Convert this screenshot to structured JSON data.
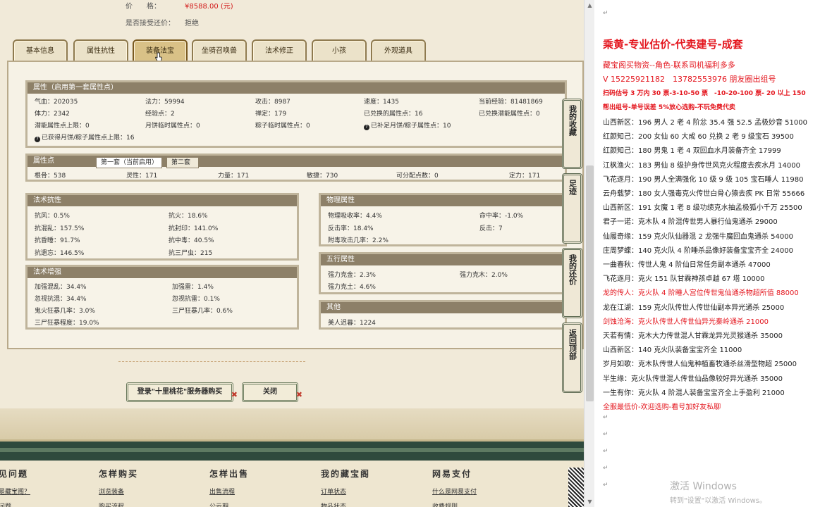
{
  "listing": {
    "price_label": "价　　格：",
    "price_value": "¥8588.00 (元)",
    "bargain_label": "是否接受还价：",
    "bargain_value": "拒绝"
  },
  "tabs": [
    "基本信息",
    "属性抗性",
    "装备法宝",
    "坐骑召唤兽",
    "法术修正",
    "小孩",
    "外观道具"
  ],
  "attr": {
    "title": "属性（启用第一套属性点）",
    "rows": [
      [
        "气血：202035",
        "法力：59994",
        "攻击：8987",
        "速度：1435",
        "当前经验：81481869"
      ],
      [
        "体力：2342",
        "经验点：2",
        "禅定：179",
        "已兑换的属性点：16",
        "已兑换潜能属性点：0"
      ],
      [
        "潜能属性点上限：0",
        "月饼临时属性点：0",
        "粽子临时属性点：0",
        "已补足月饼/粽子属性点：10",
        ""
      ]
    ],
    "note": "已获得月饼/粽子属性点上限：16"
  },
  "points": {
    "title": "属性点",
    "subtabs": [
      "第一套（当前启用）",
      "第二套"
    ],
    "row": [
      "根骨：538",
      "灵性：171",
      "力量：171",
      "敏捷：730",
      "可分配点数：0",
      "定力：171"
    ]
  },
  "resist": {
    "title": "法术抗性",
    "rows": [
      [
        "抗风：0.5%",
        "抗火：18.6%"
      ],
      [
        "抗混乱：157.5%",
        "抗封印：141.0%"
      ],
      [
        "抗昏睡：91.7%",
        "抗中毒：40.5%"
      ],
      [
        "抗遗忘：146.5%",
        "抗三尸虫：215"
      ]
    ]
  },
  "physical": {
    "title": "物理属性",
    "rows": [
      [
        "物理吸收率：4.4%",
        "命中率：-1.0%"
      ],
      [
        "反击率：18.4%",
        "反击：7"
      ],
      [
        "附毒攻击几率：2.2%",
        ""
      ]
    ]
  },
  "enhance": {
    "title": "法术增强",
    "rows": [
      [
        "加强混乱：34.4%",
        "加强雷：1.4%"
      ],
      [
        "忽视抗混：34.4%",
        "忽视抗雷：0.1%"
      ],
      [
        "鬼火狂暴几率：3.0%",
        "三尸狂暴几率：0.6%"
      ],
      [
        "三尸狂暴程度：19.0%",
        ""
      ]
    ]
  },
  "five": {
    "title": "五行属性",
    "rows": [
      [
        "强力克金：2.3%",
        "强力克木：2.0%"
      ],
      [
        "强力克土：4.6%",
        ""
      ]
    ]
  },
  "other": {
    "title": "其他",
    "rows": [
      "美人迟暮：1224"
    ]
  },
  "buttons": {
    "login": "登录\"十里桃花\"服务器购买",
    "close": "关闭"
  },
  "side_tabs": [
    "我的收藏",
    "足迹",
    "我的还价",
    "返回顶部"
  ],
  "footer": [
    {
      "h": "见问题",
      "l1": "是藏宝阁？",
      "l2": "问题"
    },
    {
      "h": "怎样购买",
      "l1": "浏览装备",
      "l2": "购买流程"
    },
    {
      "h": "怎样出售",
      "l1": "出售流程",
      "l2": "公示期"
    },
    {
      "h": "我的藏宝阁",
      "l1": "订单状态",
      "l2": "物品状态"
    },
    {
      "h": "网易支付",
      "l1": "什么是网易支付",
      "l2": "收费规则"
    }
  ],
  "right": {
    "title": "乘黄-专业估价-代卖建号-成套",
    "line2": "藏宝阁买物资--角色-联系司机福利多多",
    "line3": "V 15225921182　13782553976 朋友圈出组号",
    "line4": "扫码估号 3 万内 30 票-3-10-50 票　-10-20-100 票- 20 以上 150",
    "line5": "帮出组号-单号误差 5%放心选购-不玩免费代卖",
    "items": [
      {
        "t": "山西新区：196 男人 2 老 4 阶忿 35.4 强 52.5 孟极妙音 51000",
        "red": false
      },
      {
        "t": "红颜知己：200 女仙 60 大成 60 兑换 2 老 9 级宝石 39500",
        "red": false
      },
      {
        "t": "红颜知己：180 男鬼 1 老 4 双回血水月装备齐全 17999",
        "red": false
      },
      {
        "t": "江枫渔火：183 男仙 8 级护身传世风克火程度去疾水月 14000",
        "red": false
      },
      {
        "t": "飞花逐月：190 男人全满强化 10 级 9 级 105 宝石睡人 11980",
        "red": false
      },
      {
        "t": "云舟载梦：180 女人强毒克火传世白骨心猿去疾 PK 日常 55666",
        "red": false
      },
      {
        "t": "山西新区：191 女魔 1 老 8 级功绩克水抽孟极狐小千万 25500",
        "red": false
      },
      {
        "t": "君子一诺：克木队 4 阶混传世男人暴行仙鬼通杀 29000",
        "red": false
      },
      {
        "t": "仙履奇缘：159 克火队仙器混 2 龙强牛魔回血鬼通杀 54000",
        "red": false
      },
      {
        "t": "庄周梦蝶：140 克火队 4 阶睡杀品像好装备宝宝齐全 24000",
        "red": false
      },
      {
        "t": "一曲春秋：传世人鬼 4 阶仙日常任务副本通杀 47000",
        "red": false
      },
      {
        "t": "飞花逐月：克火 151 队甘霖神孩卓越 67 塔 10000",
        "red": false
      },
      {
        "t": "龙的传人：克火队 4 阶睡人宫位传世鬼仙通杀物超所值 88000",
        "red": true
      },
      {
        "t": "龙在江湖：159 克火队传世人传世仙副本异光通杀 25000",
        "red": false
      },
      {
        "t": "剑蚀沧海：克火队传世人传世仙异光秦岭通杀 21000",
        "red": true
      },
      {
        "t": "天若有情：克木大力传世混人甘霖龙异光灵猴通杀 35000",
        "red": false
      },
      {
        "t": "山西新区：140 克火队装备宝宝齐全 11000",
        "red": false
      },
      {
        "t": "岁月如歌：克木队传世人仙鬼种植畜牧通杀丝滑型物超 25000",
        "red": false
      },
      {
        "t": "半生缘：克火队传世混人传世仙品像较好异光通杀 35000",
        "red": false
      },
      {
        "t": "一生有你：克火队 4 阶混人装备宝宝齐全上手盈利 21000",
        "red": false
      },
      {
        "t": "全服最低价-欢迎选购-看号加好友私聊",
        "red": true
      }
    ],
    "watermark1": "激活 Windows",
    "watermark2": "转到\"设置\"以激活 Windows。"
  },
  "colors": {
    "accent_red": "#e4161e",
    "panel_head": "#8d8068",
    "price_red": "#d21a1a"
  }
}
